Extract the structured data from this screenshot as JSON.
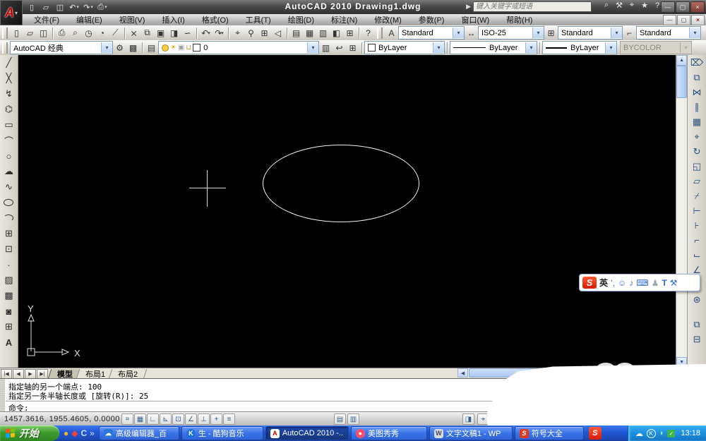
{
  "window": {
    "title": "AutoCAD 2010  Drawing1.dwg",
    "search_placeholder": "键入关键字或短语"
  },
  "menus": [
    "文件(F)",
    "编辑(E)",
    "视图(V)",
    "插入(I)",
    "格式(O)",
    "工具(T)",
    "绘图(D)",
    "标注(N)",
    "修改(M)",
    "参数(P)",
    "窗口(W)",
    "帮助(H)"
  ],
  "styles_toolbar": {
    "text_style": "Standard",
    "dim_style": "ISO-25",
    "table_style": "Standard",
    "mleader_style": "Standard"
  },
  "workspace_toolbar": {
    "workspace": "AutoCAD 经典"
  },
  "layers_toolbar": {
    "layer_name": "0"
  },
  "properties_toolbar": {
    "color": "ByLayer",
    "linetype": "ByLayer",
    "lineweight": "ByLayer",
    "plot_style": "BYCOLOR"
  },
  "canvas": {
    "ucs_x_label": "X",
    "ucs_y_label": "Y"
  },
  "layout_tabs": [
    "模型",
    "布局1",
    "布局2"
  ],
  "command_line": {
    "line1": "指定轴的另一个端点: 100",
    "line2": "指定另一条半轴长度或 [旋转(R)]: 25",
    "prompt": "命令:"
  },
  "status_bar": {
    "coordinates": "1457.3616, 1955.4605, 0.0000"
  },
  "taskbar": {
    "start_label": "开始",
    "quick_launch_more": "»",
    "tasks": [
      {
        "label": "高级编辑器_百"
      },
      {
        "label": "生 - 酷狗音乐"
      },
      {
        "label": "AutoCAD 2010 -.."
      },
      {
        "label": "美图秀秀"
      },
      {
        "label": "文字文稿1 - WP"
      },
      {
        "label": "符号大全"
      }
    ],
    "tray_time": "13:18"
  },
  "ime": {
    "logo": "S",
    "mode": "英",
    "punct": "’,"
  },
  "colors": {
    "taskbar_blue": "#2258d6",
    "start_green": "#3d9e2e",
    "accent_red": "#c40000",
    "canvas_black": "#000000",
    "xp_task_blue": "#3b74ea"
  },
  "icons": {
    "logo": "A",
    "menu_arrow": "▾",
    "dropdown": "▾",
    "new": "▯",
    "open": "▱",
    "save": "◫",
    "undo": "↶",
    "redo": "↷",
    "print": "⎙",
    "search_go": "▶",
    "binoculars": "⌕",
    "wrench": "⚒",
    "satellite": "⌖",
    "star": "★",
    "help": "?",
    "minimize": "—",
    "restore": "▢",
    "close": "×",
    "preview": "⌕",
    "plot_preview": "◔",
    "publish": "◷",
    "markup_pencil": "⟋",
    "cut": "⨯",
    "copy": "⧉",
    "paste": "▣",
    "paste_special": "◨",
    "matchprop": "∽",
    "pan": "⌖",
    "zoom": "⚲",
    "zoom_window": "⊞",
    "zoom_prev": "◁",
    "properties": "▤",
    "designcenter": "▦",
    "palettes": "▥",
    "sheetset": "◧",
    "calc": "⊞",
    "text_style": "A",
    "dim_style": "↔",
    "table_style": "⊞",
    "mleader_style": "⌐",
    "gear": "⚙",
    "workspace_save": "▩",
    "layer_mgr": "▤",
    "sun": "☀",
    "freeze": "▣",
    "lock": "⊔",
    "layer_make_current": "▥",
    "layer_prev": "↩",
    "layer_states": "⊞",
    "line": "╱",
    "xline": "╳",
    "pline": "↯",
    "polygon": "⌬",
    "rect": "▭",
    "arc": "⌒",
    "circle": "○",
    "revcloud": "☁",
    "spline": "∿",
    "insert": "⊞",
    "block": "⊡",
    "point": "∙",
    "hatch": "▨",
    "gradient": "▩",
    "region": "◙",
    "table": "⊞",
    "mtext": "A",
    "erase": "⌦",
    "mirror": "⋈",
    "offset": "∥",
    "array": "▦",
    "move": "⌖",
    "rotate": "↻",
    "scale": "◱",
    "stretch": "▱",
    "trim": "⌿",
    "extend": "⊢",
    "break_pt": "⊦",
    "break": "⌐",
    "join": "⌙",
    "chamfer": "∠",
    "fillet": "◝",
    "explode": "⊛",
    "draworder_front": "⧉",
    "draworder_back": "⊟",
    "snap": "⌗",
    "grid": "▦",
    "ortho": "∟",
    "polar": "⊾",
    "osnap": "⊡",
    "otrack": "∠",
    "ducs": "⊥",
    "dyn": "+",
    "lwt": "≡",
    "model_space": "▤",
    "qv_layouts": "▥",
    "qv_drawings": "◨",
    "s_pan": "⌖",
    "s_zoom": "⚲",
    "wheel": "◉",
    "motion": "▷",
    "up": "▲",
    "down": "▼",
    "left": "◀",
    "right": "▶",
    "tab_first": "|◀",
    "tab_prev": "◀",
    "tab_next": "▶",
    "tab_last": "▶|",
    "ql_coin": "●",
    "ql_red": "◆",
    "ql_browser": "C",
    "cloud": "☁",
    "tray_k": "K",
    "signal": "◗",
    "shield": "✓",
    "smiley": "☺",
    "mic": "♪",
    "kbd": "⌨",
    "person": "♟",
    "shirt": "T",
    "wrench2": "⚒"
  }
}
